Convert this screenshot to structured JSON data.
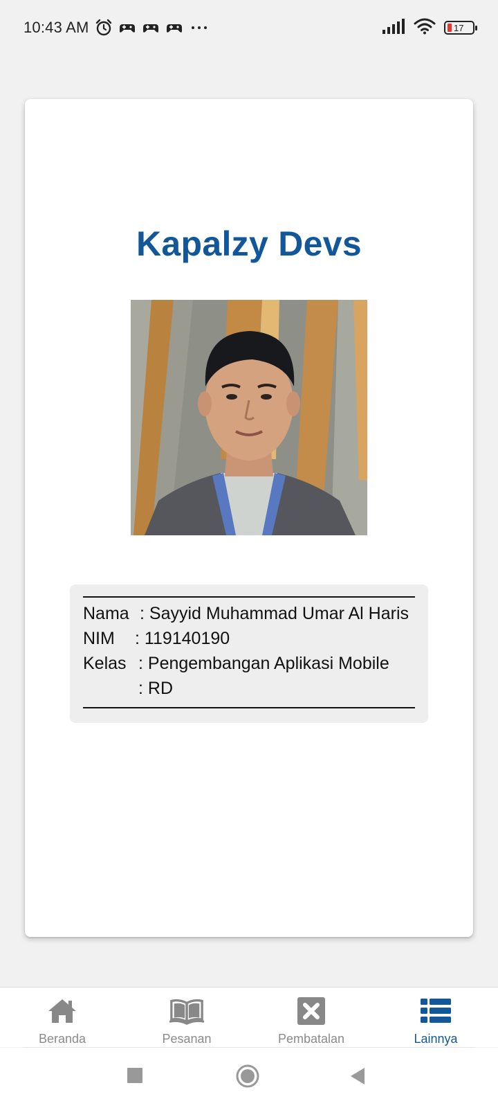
{
  "status_bar": {
    "time": "10:43 AM",
    "battery_level": "17",
    "icons": [
      "alarm-icon",
      "game-controller-icon",
      "game-controller-icon",
      "game-controller-icon",
      "more-dots-icon",
      "signal-icon",
      "wifi-icon",
      "battery-icon"
    ]
  },
  "profile": {
    "title": "Kapalzy Devs",
    "photo": "profile-photo",
    "nama_label": "Nama",
    "nama_value": ": Sayyid Muhammad Umar Al Haris",
    "nim_label": "NIM",
    "nim_value": ": 119140190",
    "kelas_label": "Kelas",
    "kelas_value": ": Pengembangan Aplikasi Mobile",
    "kelas_value2": ": RD"
  },
  "bottom_nav": {
    "items": [
      {
        "label": "Beranda",
        "icon": "home-icon",
        "active": false
      },
      {
        "label": "Pesanan",
        "icon": "book-icon",
        "active": false
      },
      {
        "label": "Pembatalan",
        "icon": "cancel-icon",
        "active": false
      },
      {
        "label": "Lainnya",
        "icon": "list-icon",
        "active": true
      }
    ]
  },
  "colors": {
    "accent": "#11579a",
    "inactive": "#8a8a8a",
    "background": "#f1f1f1"
  },
  "system_nav": [
    "recents-button",
    "home-button",
    "back-button"
  ]
}
